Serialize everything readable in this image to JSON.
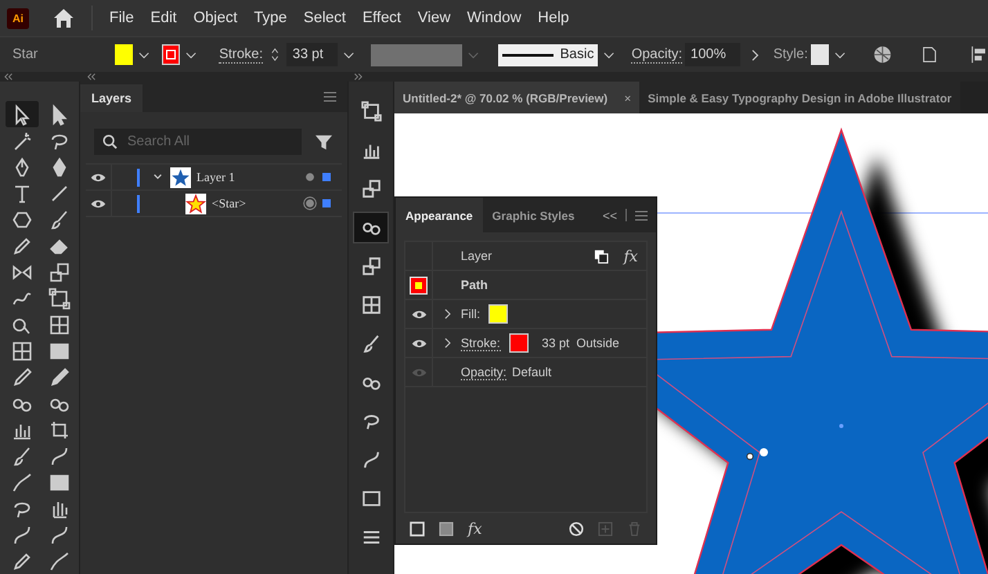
{
  "app": {
    "logo": "Ai",
    "menu": [
      "File",
      "Edit",
      "Object",
      "Type",
      "Select",
      "Effect",
      "View",
      "Window",
      "Help"
    ]
  },
  "control_bar": {
    "object_type": "Star",
    "fill": {
      "color": "#ffff00"
    },
    "stroke": {
      "color": "#ff0000"
    },
    "stroke_label": "Stroke:",
    "stroke_weight": "33 pt",
    "brush": "Basic",
    "opacity_label": "Opacity:",
    "opacity": "100%",
    "style_label": "Style:"
  },
  "toolbox": {
    "tools": [
      {
        "selected": true
      },
      {
        "selected": false
      },
      {
        "selected": false
      },
      {
        "selected": false
      },
      {
        "selected": false
      },
      {
        "selected": false
      },
      {
        "selected": false
      },
      {
        "selected": false
      },
      {
        "selected": false
      },
      {
        "selected": false
      },
      {
        "selected": false
      },
      {
        "selected": false
      },
      {
        "selected": false
      },
      {
        "selected": false
      },
      {
        "selected": false
      },
      {
        "selected": false
      },
      {
        "selected": false
      },
      {
        "selected": false
      },
      {
        "selected": false
      },
      {
        "selected": false
      },
      {
        "selected": false
      },
      {
        "selected": false
      },
      {
        "selected": false
      },
      {
        "selected": false
      },
      {
        "selected": false
      },
      {
        "selected": false
      },
      {
        "selected": false
      },
      {
        "selected": false
      },
      {
        "selected": false
      },
      {
        "selected": false
      },
      {
        "selected": false
      },
      {
        "selected": false
      },
      {
        "selected": false
      },
      {
        "selected": false
      },
      {
        "selected": false
      },
      {
        "selected": false
      }
    ]
  },
  "layers_panel": {
    "tab": "Layers",
    "search": {
      "placeholder": "Search All"
    },
    "layers": [
      {
        "name": "Layer 1",
        "visible": true,
        "expanded": true,
        "targeted": false,
        "color": "#3f7fff",
        "children": [
          {
            "name": "<Star>",
            "visible": true,
            "targeted": true,
            "color": "#3f7fff"
          }
        ]
      }
    ]
  },
  "dock": {
    "items": [
      {
        "selected": false
      },
      {
        "selected": false
      },
      {
        "selected": false
      },
      {
        "selected": true
      },
      {
        "selected": false
      },
      {
        "selected": false
      },
      {
        "selected": false
      },
      {
        "selected": false
      },
      {
        "selected": false
      },
      {
        "selected": false
      },
      {
        "selected": false
      },
      {
        "selected": false
      }
    ]
  },
  "documents": {
    "tabs": [
      {
        "label": "Untitled-2* @ 70.02 % (RGB/Preview)",
        "selected": true,
        "close": "×"
      },
      {
        "label": "Simple & Easy Typography Design in Adobe Illustrator",
        "selected": false
      }
    ]
  },
  "appearance_panel": {
    "tabs": [
      {
        "label": "Appearance",
        "selected": true
      },
      {
        "label": "Graphic Styles",
        "selected": false
      }
    ],
    "collapse": "<<",
    "layer_label": "Layer",
    "fx": "fx",
    "object": "Path",
    "rows": [
      {
        "kind": "attribute",
        "label": "Fill:",
        "link": false,
        "visible": true,
        "color": "#ffff00"
      },
      {
        "kind": "attribute",
        "label": "Stroke:",
        "link": true,
        "visible": true,
        "color": "#ff0000",
        "value": "33 pt  Outside"
      },
      {
        "kind": "opacity",
        "label": "Opacity:",
        "link": true,
        "visible": false,
        "value": "Default"
      }
    ],
    "footer_fx": "fx"
  }
}
